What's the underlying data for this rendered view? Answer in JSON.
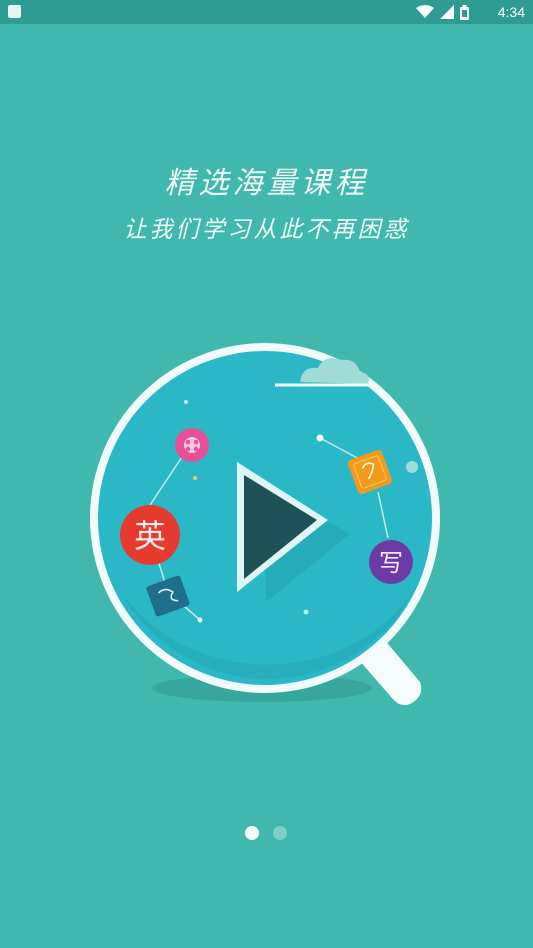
{
  "status_bar": {
    "time": "4:34",
    "icons": [
      "app-notification-icon",
      "wifi-icon",
      "signal-icon",
      "battery-icon"
    ]
  },
  "onboarding": {
    "title": "精选海量课程",
    "subtitle": "让我们学习从此不再困惑",
    "badges": {
      "english": "英",
      "writing": "写"
    },
    "page_indicator": {
      "current": 1,
      "total": 2
    }
  },
  "colors": {
    "background": "#41b8ae",
    "lens": "#2bb8c6",
    "play": "#1f5257",
    "english_badge": "#e53b2f",
    "writing_badge": "#6b3aa6",
    "video_badge": "#e84f96",
    "orange_badge": "#f19a1c"
  }
}
